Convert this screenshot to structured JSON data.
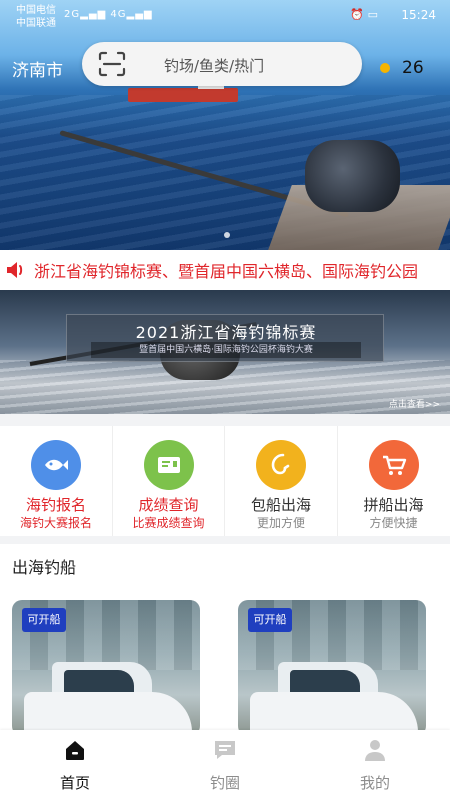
{
  "status_bar": {
    "carrier_1": "中国电信",
    "carrier_2": "中国联通",
    "signal_1": "2G",
    "signal_2": "4G",
    "time": "15:24"
  },
  "header": {
    "city": "济南市",
    "search_placeholder": "钓场/鱼类/热门",
    "temperature": "26"
  },
  "notice": {
    "text": "浙江省海钓锦标赛、暨首届中国六横岛、国际海钓公园"
  },
  "event_banner": {
    "title": "2021浙江省海钓锦标赛",
    "subtitle": "暨首届中国六横岛·国际海钓公园杯海钓大赛",
    "more": "点击查看>>"
  },
  "quick_menu": [
    {
      "title": "海钓报名",
      "subtitle": "海钓大赛报名",
      "icon": "fish-icon",
      "color": "#4f8fe8"
    },
    {
      "title": "成绩查询",
      "subtitle": "比赛成绩查询",
      "icon": "ticket-icon",
      "color": "#7dc24b"
    },
    {
      "title": "包船出海",
      "subtitle": "更加方便",
      "icon": "fishing-hook-icon",
      "color": "#f2b21d"
    },
    {
      "title": "拼船出海",
      "subtitle": "方便快捷",
      "icon": "cart-icon",
      "color": "#f2683a"
    }
  ],
  "section": {
    "title": "出海钓船"
  },
  "boats": [
    {
      "badge": "可开船"
    },
    {
      "badge": "可开船"
    }
  ],
  "tabs": [
    {
      "label": "首页",
      "icon": "home-icon",
      "active": true
    },
    {
      "label": "钓圈",
      "icon": "chat-icon",
      "active": false
    },
    {
      "label": "我的",
      "icon": "user-icon",
      "active": false
    }
  ],
  "colors": {
    "accent_red": "#e0262b",
    "badge_blue": "#1f3fbf"
  }
}
